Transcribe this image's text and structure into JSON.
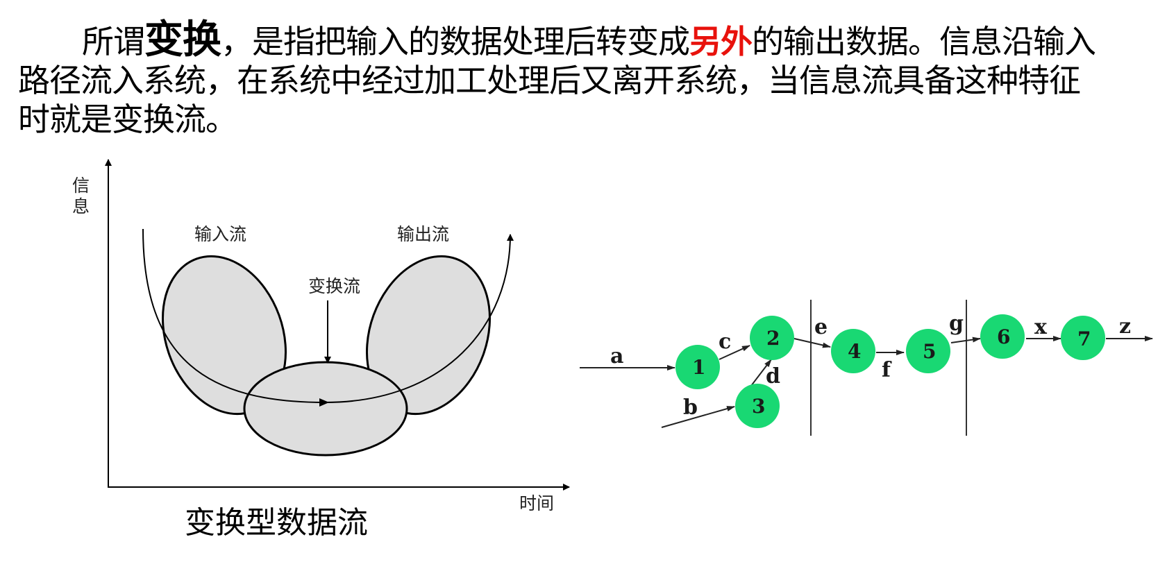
{
  "paragraph": {
    "part1": "所谓",
    "part2_bold": "变换",
    "part3": "，是指把输入的数据处理后转变成",
    "part4_red": "另外",
    "part5": "的输出数据。信息沿输入",
    "line2": "路径流入系统，在系统中经过加工处理后又离开系统，当信息流具备这种特征",
    "line3": "时就是变换流。"
  },
  "left_diagram": {
    "y_axis_label": "信息",
    "x_axis_label": "时间",
    "input_flow_label": "输入流",
    "output_flow_label": "输出流",
    "transform_flow_label": "变换流",
    "caption": "变换型数据流",
    "fill_color": "#dedede"
  },
  "right_diagram": {
    "node_color": "#19d873",
    "nodes": [
      "1",
      "2",
      "3",
      "4",
      "5",
      "6",
      "7"
    ],
    "flows": [
      "a",
      "b",
      "c",
      "d",
      "e",
      "f",
      "g",
      "x",
      "z"
    ]
  }
}
